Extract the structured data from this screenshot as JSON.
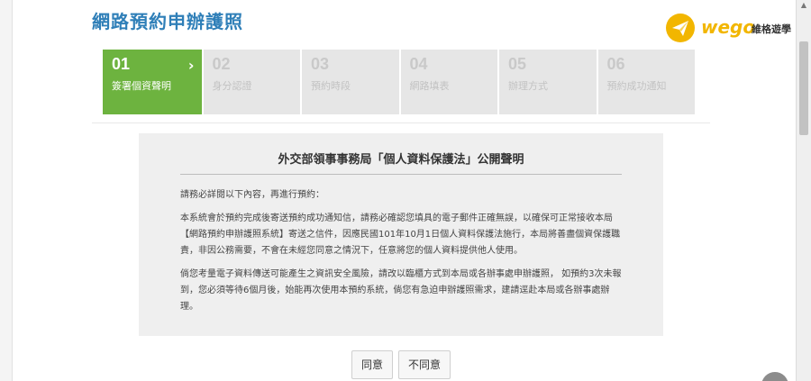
{
  "header": {
    "title": "網路預約申辦護照"
  },
  "logo": {
    "brand": "wego",
    "subtitle": "維格遊學",
    "color": "#f2b600",
    "icon": "paper-plane-icon"
  },
  "steps": [
    {
      "num": "01",
      "label": "簽署個資聲明",
      "active": true
    },
    {
      "num": "02",
      "label": "身分認證",
      "active": false
    },
    {
      "num": "03",
      "label": "預約時段",
      "active": false
    },
    {
      "num": "04",
      "label": "網路填表",
      "active": false
    },
    {
      "num": "05",
      "label": "辦理方式",
      "active": false
    },
    {
      "num": "06",
      "label": "預約成功通知",
      "active": false
    }
  ],
  "notice": {
    "title": "外交部領事事務局「個人資料保護法」公開聲明",
    "paragraphs": [
      "請務必詳閱以下內容，再進行預約：",
      "本系統會於預約完成後寄送預約成功通知信，請務必確認您填具的電子郵件正確無誤，以確保可正常接收本局【網路預約申辦護照系統】寄送之信件，因應民國101年10月1日個人資料保護法施行，本局將善盡個資保護職責，非因公務需要，不會在未經您同意之情況下，任意將您的個人資料提供他人使用。",
      "倘您考量電子資料傳送可能產生之資訊安全風險，請改以臨櫃方式到本局或各辦事處申辦護照， 如預約3次未報到，您必須等待6個月後，始能再次使用本預約系統，倘您有急迫申辦護照需求，建請逕赴本局或各辦事處辦理。"
    ]
  },
  "buttons": {
    "agree": "同意",
    "disagree": "不同意"
  },
  "colors": {
    "accent": "#6db33f",
    "title": "#2f7fb8"
  }
}
